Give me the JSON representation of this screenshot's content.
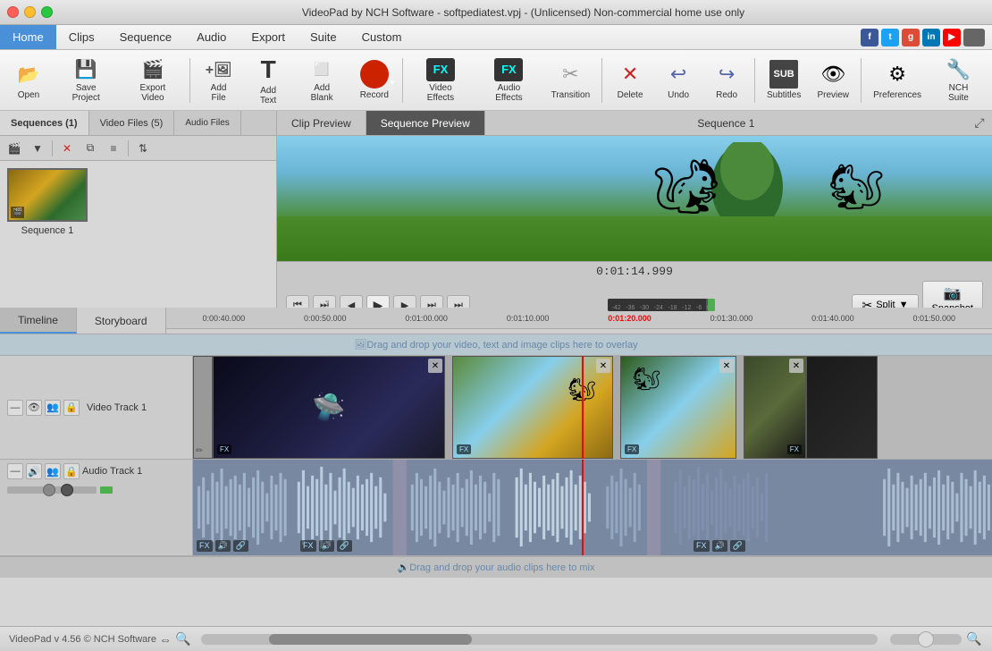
{
  "titleBar": {
    "title": "VideoPad by NCH Software - softpediatest.vpj - (Unlicensed) Non-commercial home use only"
  },
  "menuBar": {
    "items": [
      {
        "id": "home",
        "label": "Home",
        "active": true
      },
      {
        "id": "clips",
        "label": "Clips"
      },
      {
        "id": "sequence",
        "label": "Sequence"
      },
      {
        "id": "audio",
        "label": "Audio"
      },
      {
        "id": "export",
        "label": "Export"
      },
      {
        "id": "suite",
        "label": "Suite"
      },
      {
        "id": "custom",
        "label": "Custom"
      }
    ]
  },
  "toolbar": {
    "buttons": [
      {
        "id": "open",
        "label": "Open",
        "icon": "📂"
      },
      {
        "id": "save-project",
        "label": "Save Project",
        "icon": "💾"
      },
      {
        "id": "export-video",
        "label": "Export Video",
        "icon": "🎬"
      },
      {
        "id": "add-file",
        "label": "Add File",
        "icon": "➕"
      },
      {
        "id": "add-text",
        "label": "Add Text",
        "icon": "T"
      },
      {
        "id": "add-blank",
        "label": "Add Blank",
        "icon": "⬜"
      },
      {
        "id": "record",
        "label": "Record",
        "icon": "⏺"
      },
      {
        "id": "video-effects",
        "label": "Video Effects",
        "icon": "FX"
      },
      {
        "id": "audio-effects",
        "label": "Audio Effects",
        "icon": "FX"
      },
      {
        "id": "transition",
        "label": "Transition",
        "icon": "↔"
      },
      {
        "id": "delete",
        "label": "Delete",
        "icon": "✕"
      },
      {
        "id": "undo",
        "label": "Undo",
        "icon": "↩"
      },
      {
        "id": "redo",
        "label": "Redo",
        "icon": "↪"
      },
      {
        "id": "subtitles",
        "label": "Subtitles",
        "icon": "SUB"
      },
      {
        "id": "preview",
        "label": "Preview",
        "icon": "👁"
      },
      {
        "id": "preferences",
        "label": "Preferences",
        "icon": "⚙"
      },
      {
        "id": "nch-suite",
        "label": "NCH Suite",
        "icon": "🔧"
      }
    ]
  },
  "leftPanel": {
    "tabs": [
      {
        "id": "sequences",
        "label": "Sequences (1)",
        "active": true
      },
      {
        "id": "video-files",
        "label": "Video Files (5)"
      },
      {
        "id": "audio-files",
        "label": "Audio Files"
      }
    ],
    "sequences": [
      {
        "id": "seq1",
        "label": "Sequence 1"
      }
    ]
  },
  "previewPanel": {
    "tabs": [
      {
        "id": "clip-preview",
        "label": "Clip Preview"
      },
      {
        "id": "sequence-preview",
        "label": "Sequence Preview",
        "active": true
      }
    ],
    "title": "Sequence 1",
    "timecode": "0:01:14.999"
  },
  "timeline": {
    "tabs": [
      {
        "id": "timeline",
        "label": "Timeline",
        "active": true
      },
      {
        "id": "storyboard",
        "label": "Storyboard"
      }
    ],
    "rulerMarks": [
      "0:00:40.000",
      "0:00:50.000",
      "0:01:00.000",
      "0:01:10.000",
      "0:01:20.000",
      "0:01:30.000",
      "0:01:40.000",
      "0:01:50.000"
    ],
    "videoTrack": {
      "label": "Video Track 1",
      "overlayText": "Drag and drop your video, text and image clips here to overlay"
    },
    "audioTrack": {
      "label": "Audio Track 1",
      "dropText": "Drag and drop your audio clips here to mix"
    }
  },
  "bottomBar": {
    "version": "VideoPad v 4.56 © NCH Software"
  },
  "snapshot": {
    "label": "Snapshot"
  },
  "split": {
    "label": "Split"
  }
}
